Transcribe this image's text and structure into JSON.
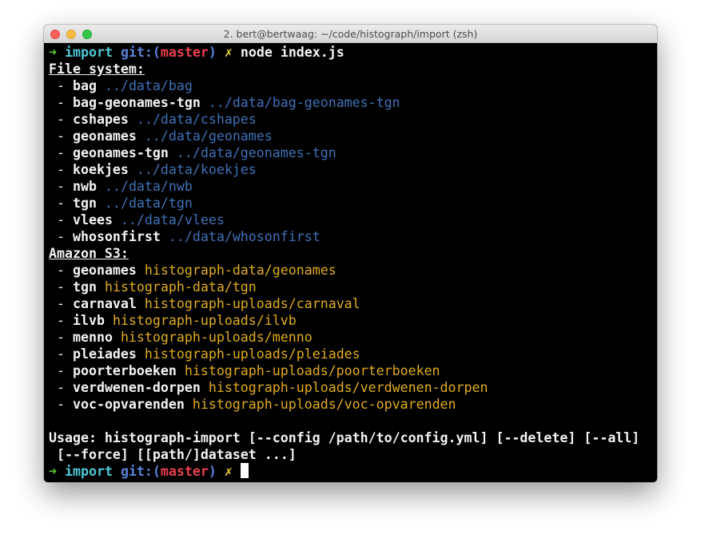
{
  "window": {
    "title": "2. bert@bertwaag: ~/code/histograph/import (zsh)"
  },
  "prompt": {
    "arrow": "➜",
    "directory": "import",
    "git_label": "git:",
    "paren_open": "(",
    "branch": "master",
    "paren_close": ")",
    "dirty_mark": "✗"
  },
  "command": "node index.js",
  "filesystem": {
    "heading": "File system:",
    "items": [
      {
        "name": "bag",
        "path": "../data/bag"
      },
      {
        "name": "bag-geonames-tgn",
        "path": "../data/bag-geonames-tgn"
      },
      {
        "name": "cshapes",
        "path": "../data/cshapes"
      },
      {
        "name": "geonames",
        "path": "../data/geonames"
      },
      {
        "name": "geonames-tgn",
        "path": "../data/geonames-tgn"
      },
      {
        "name": "koekjes",
        "path": "../data/koekjes"
      },
      {
        "name": "nwb",
        "path": "../data/nwb"
      },
      {
        "name": "tgn",
        "path": "../data/tgn"
      },
      {
        "name": "vlees",
        "path": "../data/vlees"
      },
      {
        "name": "whosonfirst",
        "path": "../data/whosonfirst"
      }
    ]
  },
  "s3": {
    "heading": "Amazon S3:",
    "items": [
      {
        "name": "geonames",
        "path": "histograph-data/geonames"
      },
      {
        "name": "tgn",
        "path": "histograph-data/tgn"
      },
      {
        "name": "carnaval",
        "path": "histograph-uploads/carnaval"
      },
      {
        "name": "ilvb",
        "path": "histograph-uploads/ilvb"
      },
      {
        "name": "menno",
        "path": "histograph-uploads/menno"
      },
      {
        "name": "pleiades",
        "path": "histograph-uploads/pleiades"
      },
      {
        "name": "poorterboeken",
        "path": "histograph-uploads/poorterboeken"
      },
      {
        "name": "verdwenen-dorpen",
        "path": "histograph-uploads/verdwenen-dorpen"
      },
      {
        "name": "voc-opvarenden",
        "path": "histograph-uploads/voc-opvarenden"
      }
    ]
  },
  "usage": {
    "line1": "Usage: histograph-import [--config /path/to/config.yml] [--delete] [--all]",
    "line2": " [--force] [[path/]dataset ...]"
  },
  "colors": {
    "prompt_arrow": "#5ad130",
    "prompt_dir": "#4ec7d6",
    "git_label": "#5b82d8",
    "branch": "#ea3f4f",
    "dirty_mark": "#e9d13b",
    "fs_path": "#3f71b8",
    "s3_path": "#dfac1a",
    "background": "#000000",
    "foreground": "#f2f2f2"
  }
}
